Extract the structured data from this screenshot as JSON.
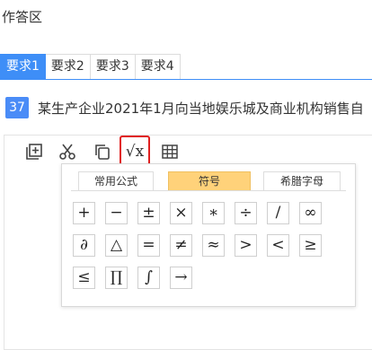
{
  "section_title": "作答区",
  "requirement_tabs": [
    {
      "label": "要求1",
      "active": true
    },
    {
      "label": "要求2",
      "active": false
    },
    {
      "label": "要求3",
      "active": false
    },
    {
      "label": "要求4",
      "active": false
    }
  ],
  "question": {
    "number": "37",
    "text": "某生产企业2021年1月向当地娱乐城及商业机构销售自"
  },
  "toolbar": {
    "icons": [
      "add-box-icon",
      "scissors-icon",
      "copy-icon",
      "sqrt-formula-icon",
      "table-grid-icon"
    ],
    "sqrt_label": "√x",
    "highlight_color": "#e02020"
  },
  "symbol_panel": {
    "tabs": [
      {
        "label": "常用公式",
        "active": false
      },
      {
        "label": "符号",
        "active": true
      },
      {
        "label": "希腊字母",
        "active": false
      }
    ],
    "symbols": [
      [
        "+",
        "−",
        "±",
        "×",
        "∗",
        "÷",
        "/",
        "∞"
      ],
      [
        "∂",
        "△",
        "=",
        "≠",
        "≈",
        ">",
        "<",
        "≥"
      ],
      [
        "≤",
        "∏",
        "∫",
        "→"
      ]
    ]
  },
  "colors": {
    "tab_active": "#3e8ef7",
    "question_badge": "#4a8cf7",
    "panel_tab_active": "#ffd27a"
  }
}
